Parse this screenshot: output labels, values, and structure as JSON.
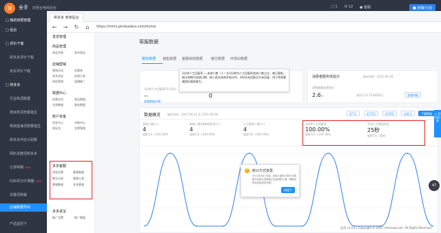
{
  "app": {
    "logo": "全",
    "name": "全手",
    "subtitle": "的柜台电商后台",
    "top_tags": [
      "□ 1",
      "✉ 12",
      "● 客服"
    ],
    "top_button": "■ 店铺/小店"
  },
  "sidebar": {
    "items": [
      {
        "label": "□ 我的权限管理",
        "kind": "grp"
      },
      {
        "label": "□ 后台",
        "kind": "grp"
      },
      {
        "label": "□ 评价下载",
        "kind": "grp"
      },
      {
        "label": "拼多多评价下载",
        "kind": "item"
      },
      {
        "label": "京东评价下载",
        "kind": "item"
      },
      {
        "label": "□ 拼多多",
        "kind": "grp"
      },
      {
        "label": "行业热词数据",
        "kind": "item"
      },
      {
        "label": "类目热词竞量指生",
        "kind": "item"
      },
      {
        "label": "类目蓝海词竞量指生",
        "kind": "item"
      },
      {
        "label": "拼多多开店计划数",
        "kind": "item"
      },
      {
        "label": "网红关键词拼多多",
        "kind": "item"
      },
      {
        "label": "订单明细",
        "kind": "item",
        "new": "new"
      },
      {
        "label": "DSR评分计算器",
        "kind": "item",
        "new": "new"
      },
      {
        "label": "关键词拆解",
        "kind": "item"
      },
      {
        "label": "店铺数据导出",
        "kind": "item",
        "active": true
      },
      {
        "label": "产品监控下",
        "kind": "item"
      }
    ]
  },
  "browser": {
    "tab": "拼多多 商家后台",
    "url": "https://mms.pinduoduo.com/home",
    "nav": [
      "←",
      "→",
      "↻",
      "⌂"
    ]
  },
  "menu": {
    "groups": [
      {
        "head": "发货管理",
        "items": []
      },
      {
        "head": "商品管理",
        "items": [
          "商品列表",
          "发布商品"
        ]
      },
      {
        "head": "店铺营销",
        "items": [
          "营销活动",
          "优惠券",
          "多多进宝",
          "促销工具",
          "短信营销",
          "直播推广"
        ]
      },
      {
        "head": "数据中心",
        "items": [
          "经营总览",
          "商品数据",
          "交易数据",
          "服务数据"
        ]
      },
      {
        "head": "账户资金",
        "items": [
          "资金中心",
          "对账中心",
          "保证金",
          "发票管理"
        ]
      },
      {
        "head": "多多客服",
        "items": [
          "消息设置",
          "客服数据",
          "聊天记录",
          "客服工具",
          "客服数据",
          "多多客服"
        ]
      },
      {
        "head": "多多进宝",
        "items": [
          "推广设置",
          "推广数据"
        ]
      }
    ]
  },
  "content": {
    "title": "客服数据",
    "tabs": [
      "服务数据",
      "销售数据",
      "客服绩效数据",
      "催付数据",
      "开场白数据"
    ],
    "tooltip": "3分钟人工回复率 = 咨询人数（人）在3分钟内人工回复的咨询人数占比；每日更新，统计周期为咨询日期，每人首次咨询开始计时，30s内未回复记为未回复；用于考核客服团队服务能力。",
    "left_card": {
      "label": "3分钟人工回复率(0-23点)",
      "value": "--",
      "link": "查看数据详情"
    },
    "mid_card": {
      "label": "当前待回复人数(人)",
      "value": "0"
    },
    "right_card": {
      "title": "消费者服务体验分",
      "date": "统计时间：2021-09-28",
      "sub": "消费者服务体验分",
      "value": "2.6",
      "unit": "分",
      "compare": "领先于12.15%的同行",
      "link": "查看明细"
    },
    "overview": {
      "title": "数据概览",
      "date": "统计时间：2021-09-22 至 2021-09-28",
      "buttons": [
        "近7天",
        "近15天",
        "近30天",
        "自定义",
        "下载数据"
      ]
    },
    "metrics": [
      {
        "label": "咨询人数(人)",
        "value": "4",
        "delta": "较前7天 +400.00%"
      },
      {
        "label": "询单人数/询单转化率(人)",
        "value": "4",
        "delta": "较前7天 +400.00%"
      },
      {
        "label": "人工接待人数(人)",
        "value": "4",
        "delta": "较前7天 +400.00%"
      },
      {
        "label": "3分钟人工回复率",
        "value": "100.00%",
        "delta": "较前7天 +100.00%"
      },
      {
        "label": "平均人工响应时长",
        "value": "25秒",
        "delta": "较前7天 -25秒"
      }
    ],
    "dialog": {
      "title": "统计方式变更",
      "body": "2021年9月1日起，咨询人数的计算方式调整为仅统计消费者主动咨询的人数（剔除系统自动发送的消息）。",
      "button": "知道了"
    }
  },
  "float_panel": "□ 切回旧版",
  "badge": "47",
  "footer": "云华 v3.0.2 | Copyright © 2021 chennew.com. All Rights Reserved",
  "chart_data": {
    "type": "line",
    "series": [
      {
        "values": [
          0,
          1,
          0,
          0,
          1,
          0,
          0,
          1,
          0,
          0,
          1,
          0
        ]
      }
    ],
    "ylim": [
      0,
      1
    ]
  }
}
